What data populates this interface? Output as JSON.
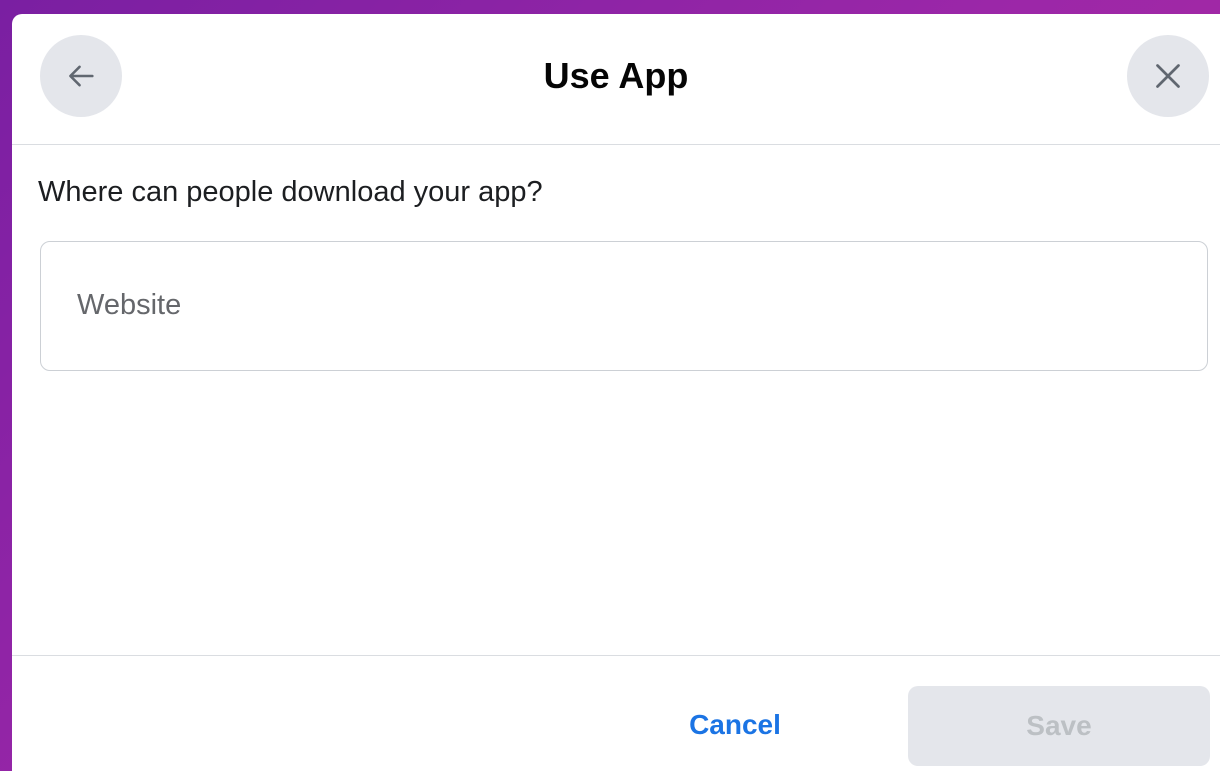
{
  "dialog": {
    "title": "Use App",
    "question": "Where can people download your app?"
  },
  "website_input": {
    "value": "",
    "placeholder": "Website"
  },
  "footer": {
    "cancel_label": "Cancel",
    "save_label": "Save",
    "save_enabled": false
  },
  "icons": {
    "back": "arrow-left-icon",
    "close": "close-x-icon"
  },
  "colors": {
    "accent": "#1b74e4",
    "button_bg": "#e4e6eb",
    "disabled_text": "#bcc0c4",
    "background_gradient_start": "#7a1fa2",
    "background_gradient_end": "#b12aa0"
  }
}
